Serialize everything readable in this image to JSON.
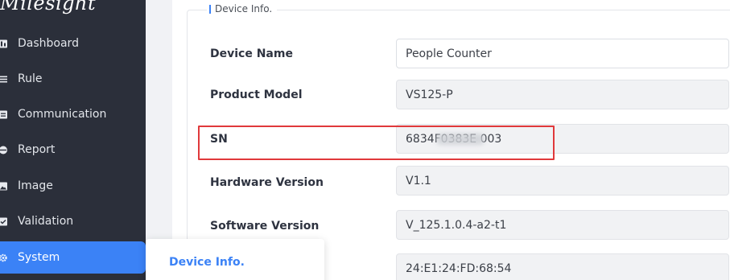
{
  "sidebar": {
    "logo_text": "Milesight",
    "items": [
      {
        "label": "Dashboard",
        "icon": "dashboard-icon",
        "active": false
      },
      {
        "label": "Rule",
        "icon": "list-icon",
        "active": false
      },
      {
        "label": "Communication",
        "icon": "communication-icon",
        "active": false
      },
      {
        "label": "Report",
        "icon": "report-icon",
        "active": false
      },
      {
        "label": "Image",
        "icon": "image-icon",
        "active": false
      },
      {
        "label": "Validation",
        "icon": "validation-icon",
        "active": false
      },
      {
        "label": "System",
        "icon": "gear-icon",
        "active": true
      }
    ]
  },
  "submenu": {
    "items": [
      {
        "label": "Device Info.",
        "active": true
      }
    ]
  },
  "section": {
    "title": "Device Info."
  },
  "device_info": {
    "rows": [
      {
        "label": "Device Name",
        "value": "People Counter",
        "editable": true
      },
      {
        "label": "Product Model",
        "value": "VS125-P",
        "editable": false
      },
      {
        "label": "SN",
        "value": "6834F0383E   003",
        "editable": false
      },
      {
        "label": "Hardware Version",
        "value": "V1.1",
        "editable": false
      },
      {
        "label": "Software Version",
        "value": "V_125.1.0.4-a2-t1",
        "editable": false
      },
      {
        "label": "",
        "value": "24:E1:24:FD:68:54",
        "editable": false
      }
    ]
  },
  "colors": {
    "accent": "#3b82f6",
    "sidebar_bg": "#2b2f3a",
    "highlight": "#e0393b"
  }
}
